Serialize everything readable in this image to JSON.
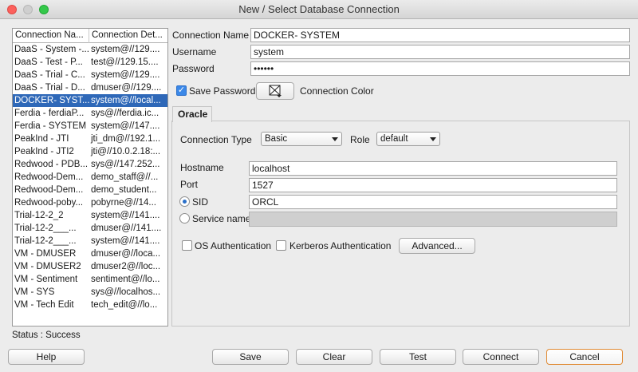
{
  "window": {
    "title": "New / Select Database Connection"
  },
  "connections": {
    "headers": [
      "Connection Na...",
      "Connection Det..."
    ],
    "rows": [
      [
        "DaaS - System -...",
        "system@//129...."
      ],
      [
        "DaaS - Test - P...",
        "test@//129.15...."
      ],
      [
        "DaaS - Trial - C...",
        "system@//129...."
      ],
      [
        "DaaS - Trial - D...",
        "dmuser@//129...."
      ],
      [
        "DOCKER- SYST...",
        "system@//local..."
      ],
      [
        "Ferdia - ferdiaP...",
        "sys@//ferdia.ic..."
      ],
      [
        "Ferdia - SYSTEM",
        "system@//147...."
      ],
      [
        "PeakInd - JTI",
        "jti_dm@//192.1..."
      ],
      [
        "PeakInd - JTI2",
        "jti@//10.0.2.18:..."
      ],
      [
        "Redwood - PDB...",
        "sys@//147.252..."
      ],
      [
        "Redwood-Dem...",
        "demo_staff@//..."
      ],
      [
        "Redwood-Dem...",
        "demo_student..."
      ],
      [
        "Redwood-poby...",
        "pobyrne@//14..."
      ],
      [
        "Trial-12-2_2",
        "system@//141...."
      ],
      [
        "Trial-12-2___...",
        "dmuser@//141...."
      ],
      [
        "Trial-12-2___...",
        "system@//141...."
      ],
      [
        "VM - DMUSER",
        "dmuser@//loca..."
      ],
      [
        "VM - DMUSER2",
        "dmuser2@//loc..."
      ],
      [
        "VM - Sentiment",
        "sentiment@//lo..."
      ],
      [
        "VM - SYS",
        "sys@//localhos..."
      ],
      [
        "VM - Tech Edit",
        "tech_edit@//lo..."
      ]
    ],
    "selected_index": 4
  },
  "status": "Status : Success",
  "form": {
    "connection_name_label": "Connection Name",
    "connection_name_value": "DOCKER- SYSTEM",
    "username_label": "Username",
    "username_value": "system",
    "password_label": "Password",
    "password_value": "••••••",
    "save_password_label": "Save Password",
    "save_password_checked": true,
    "connection_color_label": "Connection Color",
    "tab_label": "Oracle",
    "connection_type_label": "Connection Type",
    "connection_type_value": "Basic",
    "role_label": "Role",
    "role_value": "default",
    "hostname_label": "Hostname",
    "hostname_value": "localhost",
    "port_label": "Port",
    "port_value": "1527",
    "sid_label": "SID",
    "sid_value": "ORCL",
    "service_name_label": "Service name",
    "service_name_value": "",
    "os_auth_label": "OS Authentication",
    "kerberos_label": "Kerberos Authentication",
    "advanced_label": "Advanced..."
  },
  "buttons": {
    "help": "Help",
    "save": "Save",
    "clear": "Clear",
    "test": "Test",
    "connect": "Connect",
    "cancel": "Cancel"
  }
}
